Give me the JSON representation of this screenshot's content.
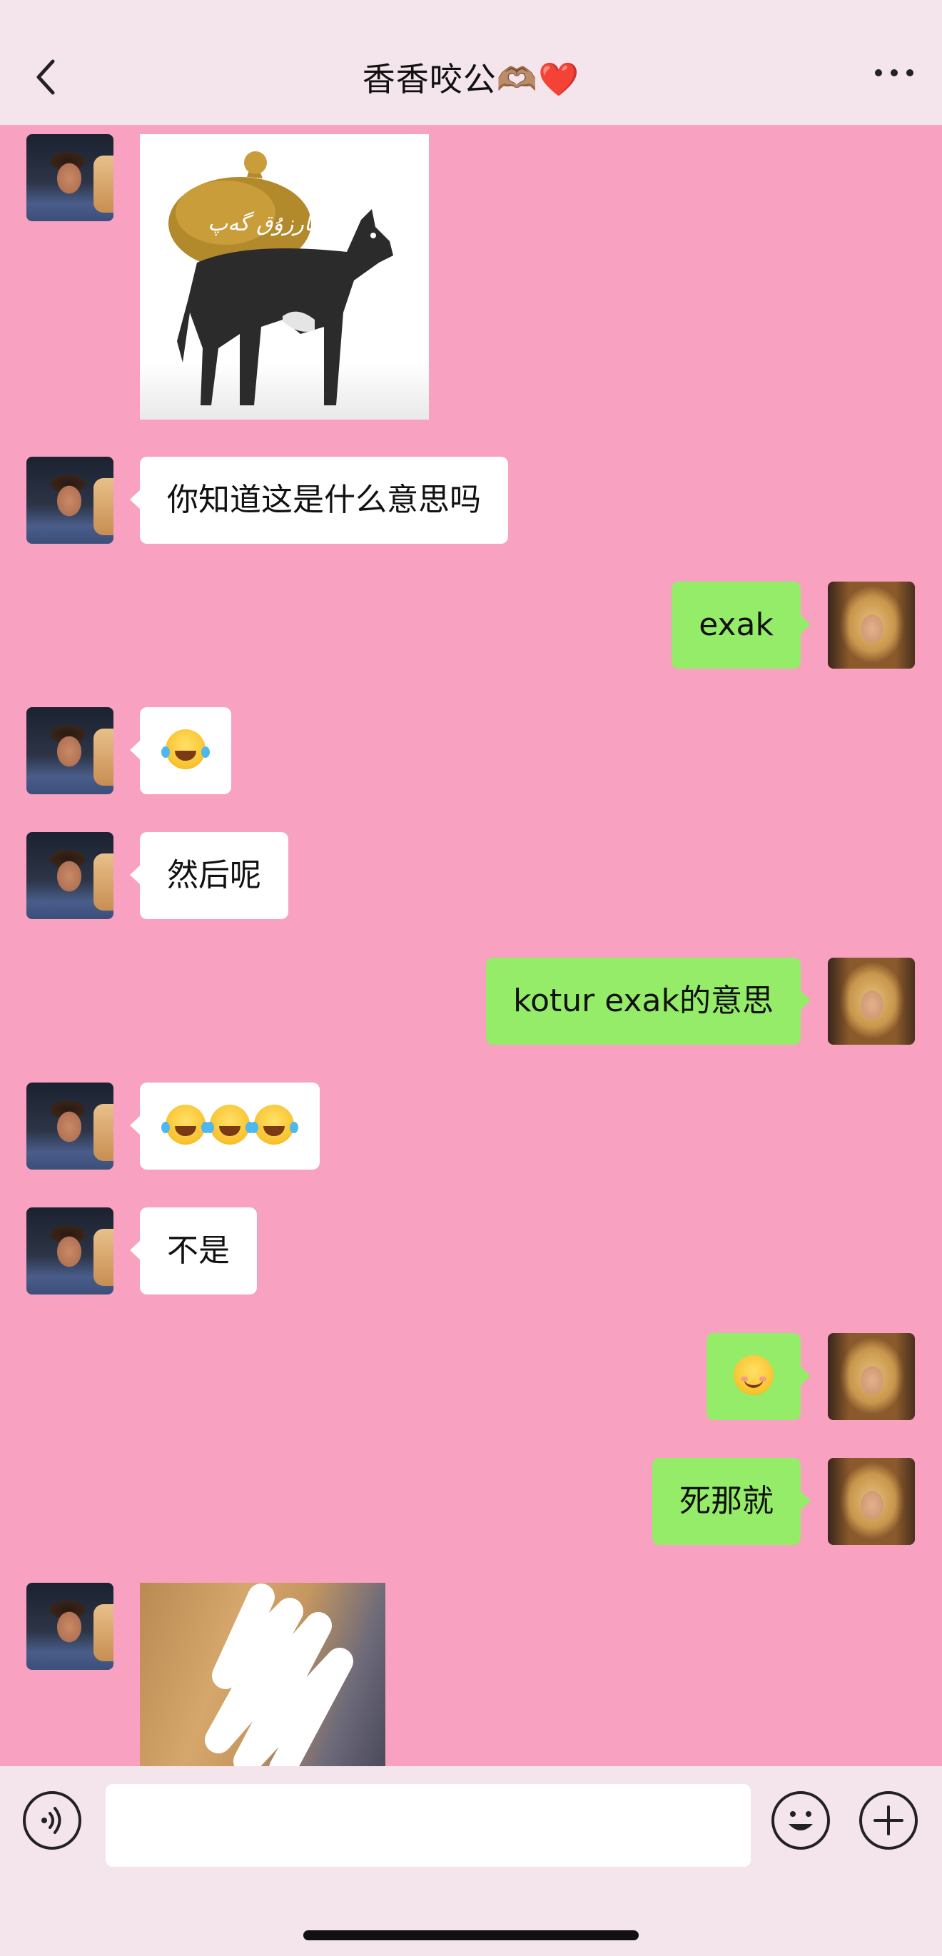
{
  "header": {
    "title": "香香咬公🫶🏽❤️",
    "back_icon": "chevron-left-icon",
    "more_icon": "ellipsis-icon"
  },
  "donkey_image": {
    "caption": "ئارزۇق گەپ"
  },
  "messages": [
    {
      "side": "left",
      "type": "image",
      "content": "donkey-with-sack"
    },
    {
      "side": "left",
      "type": "text",
      "text": "你知道这是什么意思吗"
    },
    {
      "side": "right",
      "type": "text",
      "text": "exak"
    },
    {
      "side": "left",
      "type": "emoji",
      "text": "😭"
    },
    {
      "side": "left",
      "type": "text",
      "text": "然后呢"
    },
    {
      "side": "right",
      "type": "text",
      "text": "kotur exak的意思"
    },
    {
      "side": "left",
      "type": "emoji",
      "text": "😂😂😂"
    },
    {
      "side": "left",
      "type": "text",
      "text": "不是"
    },
    {
      "side": "right",
      "type": "emoji",
      "text": "😊"
    },
    {
      "side": "right",
      "type": "text",
      "text": "死那就"
    },
    {
      "side": "left",
      "type": "image",
      "content": "photo-scribbled"
    }
  ],
  "input_bar": {
    "voice_icon": "voice-icon",
    "emoji_icon": "emoji-icon",
    "plus_icon": "plus-icon",
    "placeholder": ""
  },
  "colors": {
    "chat_bg": "#f8a1c0",
    "bar_bg": "#f4e4ec",
    "sent_bubble": "#95ec69",
    "received_bubble": "#ffffff"
  }
}
